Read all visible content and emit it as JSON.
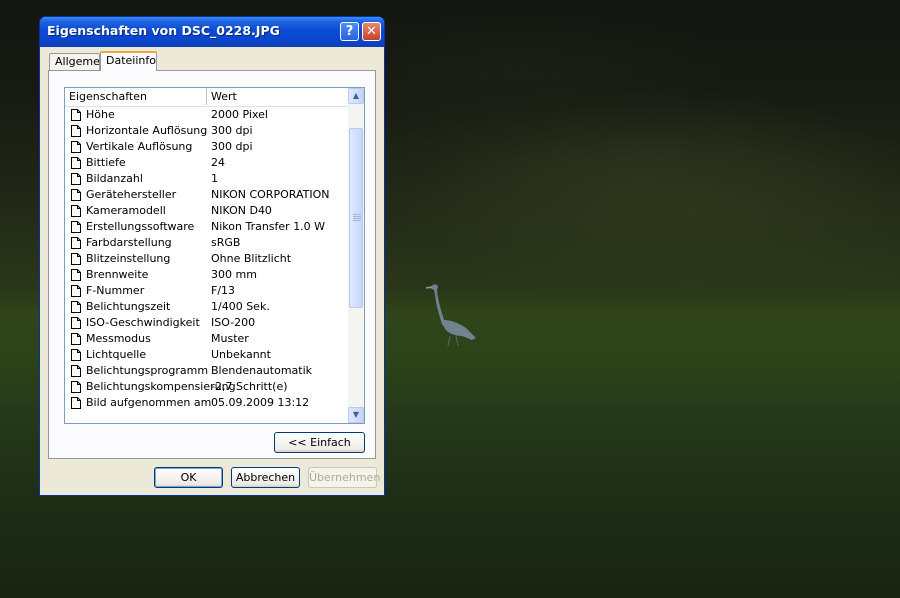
{
  "window": {
    "title": "Eigenschaften von DSC_0228.JPG",
    "help_glyph": "?",
    "close_glyph": "✕"
  },
  "tabs": [
    {
      "label": "Allgemein",
      "active": false
    },
    {
      "label": "Dateiinfo",
      "active": true
    }
  ],
  "list": {
    "columns": [
      "Eigenschaften",
      "Wert"
    ],
    "rows": [
      {
        "name": "Höhe",
        "value": "2000 Pixel"
      },
      {
        "name": "Horizontale Auflösung",
        "value": "300 dpi"
      },
      {
        "name": "Vertikale Auflösung",
        "value": "300 dpi"
      },
      {
        "name": "Bittiefe",
        "value": "24"
      },
      {
        "name": "Bildanzahl",
        "value": "1"
      },
      {
        "name": "Gerätehersteller",
        "value": "NIKON CORPORATION"
      },
      {
        "name": "Kameramodell",
        "value": "NIKON D40"
      },
      {
        "name": "Erstellungssoftware",
        "value": "Nikon Transfer 1.0 W"
      },
      {
        "name": "Farbdarstellung",
        "value": "sRGB"
      },
      {
        "name": "Blitzeinstellung",
        "value": "Ohne Blitzlicht"
      },
      {
        "name": "Brennweite",
        "value": "300 mm"
      },
      {
        "name": "F-Nummer",
        "value": "F/13"
      },
      {
        "name": "Belichtungszeit",
        "value": "1/400 Sek."
      },
      {
        "name": "ISO-Geschwindigkeit",
        "value": "ISO-200"
      },
      {
        "name": "Messmodus",
        "value": "Muster"
      },
      {
        "name": "Lichtquelle",
        "value": "Unbekannt"
      },
      {
        "name": "Belichtungsprogramm",
        "value": "Blendenautomatik"
      },
      {
        "name": "Belichtungskompensierung",
        "value": "-2,7 Schritt(e)"
      },
      {
        "name": "Bild aufgenommen am",
        "value": "05.09.2009 13:12"
      }
    ],
    "scroll_up_glyph": "▲",
    "scroll_down_glyph": "▼"
  },
  "buttons": {
    "simple": "<< Einfach",
    "ok": "OK",
    "cancel": "Abbrechen",
    "apply": "Übernehmen"
  },
  "colors": {
    "titlebar": "#0a46cf",
    "active_tab_accent": "#f1a83c",
    "dialog_face": "#ece9d8"
  }
}
